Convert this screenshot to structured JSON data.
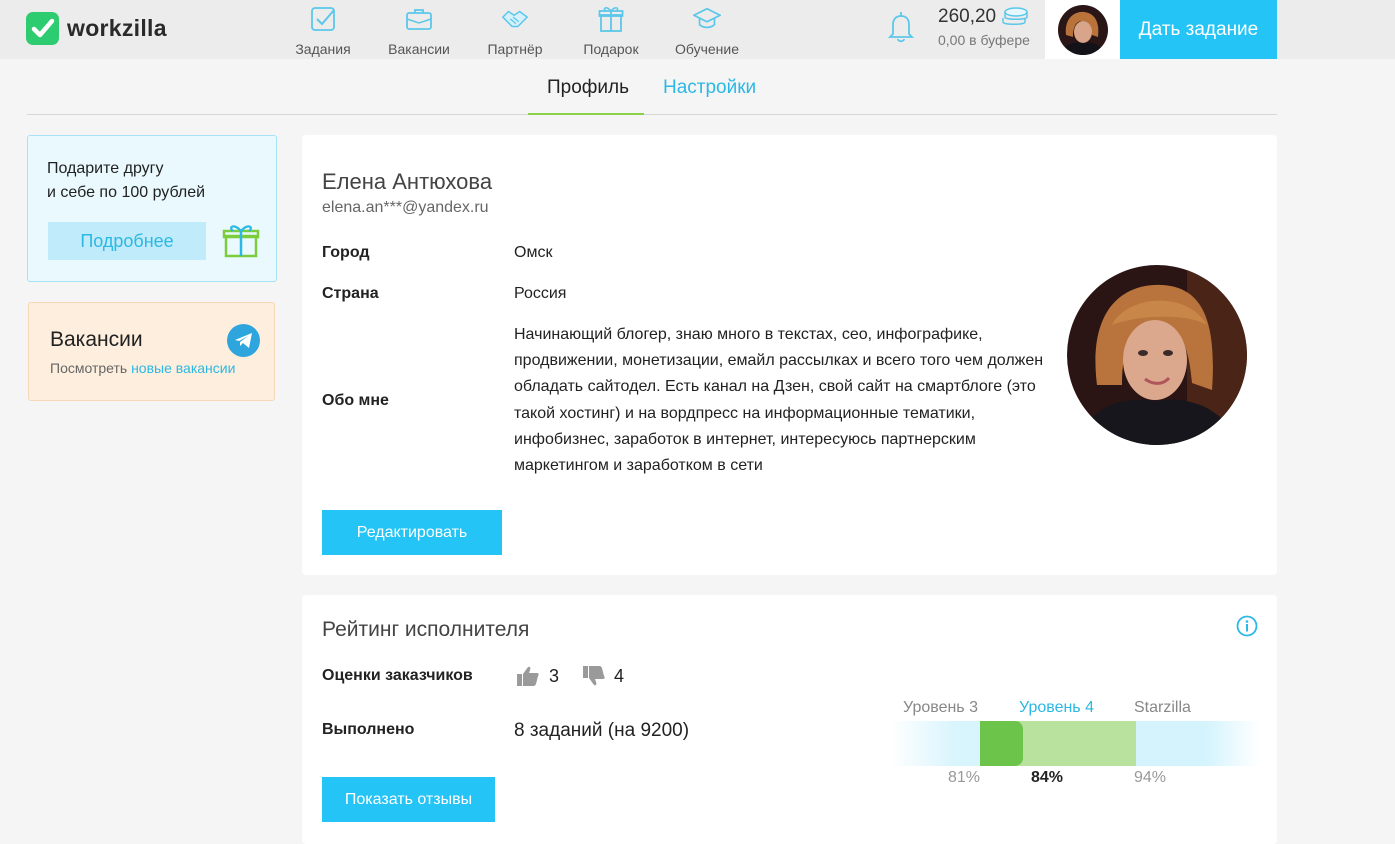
{
  "header": {
    "logo_text": "workzilla",
    "nav": [
      {
        "label": "Задания",
        "icon": "tasks-icon"
      },
      {
        "label": "Вакансии",
        "icon": "briefcase-icon"
      },
      {
        "label": "Партнёр",
        "icon": "handshake-icon"
      },
      {
        "label": "Подарок",
        "icon": "gift-icon"
      },
      {
        "label": "Обучение",
        "icon": "graduation-cap-icon"
      }
    ],
    "balance": "260,20",
    "buffer": "0,00 в буфере",
    "give_task_label": "Дать задание"
  },
  "tabs": {
    "profile": "Профиль",
    "settings": "Настройки"
  },
  "sidebar": {
    "promo_line1": "Подарите другу",
    "promo_line2": "и себе по 100 рублей",
    "promo_button": "Подробнее",
    "vacancies_title": "Вакансии",
    "vacancies_sub": "Посмотреть",
    "vacancies_link": "новые вакансии"
  },
  "profile": {
    "name": "Елена Антюхова",
    "email": "elena.an***@yandex.ru",
    "city_label": "Город",
    "city": "Омск",
    "country_label": "Страна",
    "country": "Россия",
    "about_label": "Обо мне",
    "about": "Начинающий блогер, знаю много в текстах, сео, инфографике, продвижении, монетизации, емайл рассылках и всего того чем должен обладать сайтодел. Есть канал на Дзен, свой сайт на смартблоге (это такой хостинг) и на вордпресс на информационные тематики, инфобизнес, заработок в интернет, интересуюсь партнерским маркетингом и заработком в сети",
    "edit_button": "Редактировать"
  },
  "rating": {
    "title": "Рейтинг исполнителя",
    "reviews_label": "Оценки заказчиков",
    "likes": "3",
    "dislikes": "4",
    "done_label": "Выполнено",
    "done_value": "8 заданий (на 9200)",
    "reviews_button": "Показать отзывы",
    "levels": [
      {
        "name": "Уровень 3",
        "pct": "81%",
        "value": 81
      },
      {
        "name": "Уровень 4",
        "pct": "84%",
        "value": 84,
        "current": true
      },
      {
        "name": "Starzilla",
        "pct": "94%",
        "value": 94
      }
    ]
  },
  "colors": {
    "accent": "#24c4f6",
    "link": "#2cb8e4",
    "green": "#6cc54a"
  }
}
